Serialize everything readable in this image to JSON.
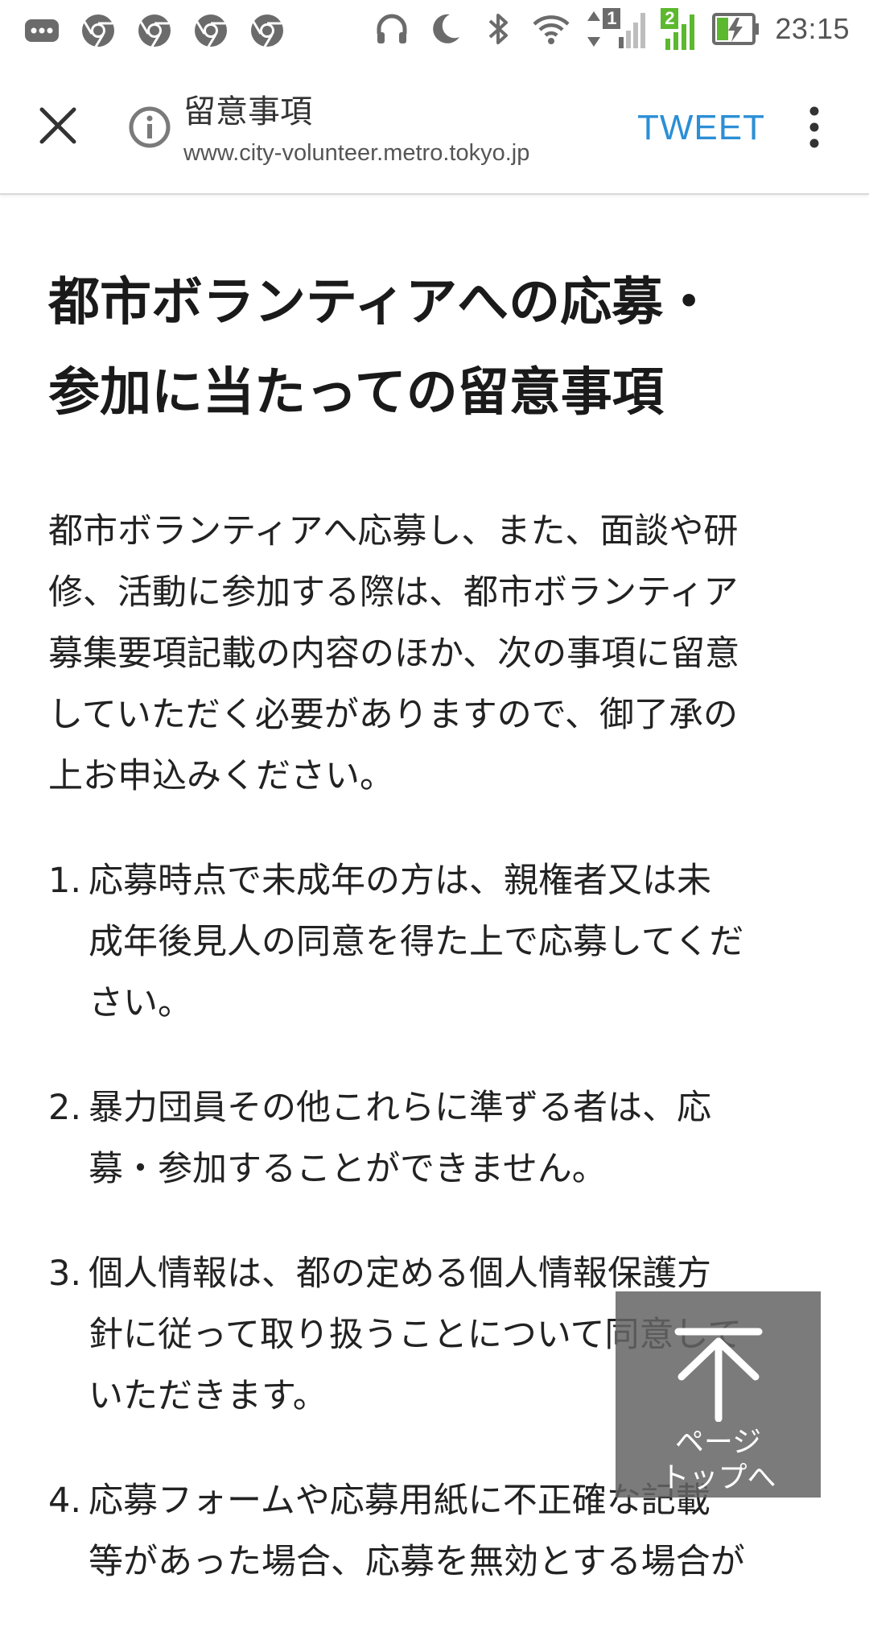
{
  "status_bar": {
    "time": "23:15",
    "sim1_label": "1",
    "sim2_label": "2",
    "notification_icons": [
      "more-icon",
      "chrome-icon",
      "chrome-icon",
      "chrome-icon",
      "chrome-icon"
    ],
    "system_icons": [
      "headphones-icon",
      "moon-icon",
      "bluetooth-icon",
      "wifi-icon",
      "signal-sim1-icon",
      "signal-sim2-icon",
      "battery-charging-icon"
    ]
  },
  "toolbar": {
    "title": "留意事項",
    "url": "www.city-volunteer.metro.tokyo.jp",
    "tweet_label": "TWEET",
    "accent_color": "#2b8fd6"
  },
  "main": {
    "title_line1": "都市ボランティアへの応募・",
    "title_line2": "参加に当たっての留意事項",
    "intro_lines": [
      "都市ボランティアへ応募し、また、面談や研",
      "修、活動に参加する際は、都市ボランティア",
      "募集要項記載の内容のほか、次の事項に留意",
      "していただく必要がありますので、御了承の",
      "上お申込みください。"
    ],
    "notes": [
      {
        "num": "1.",
        "lines": [
          "応募時点で未成年の方は、親権者又は未",
          "成年後見人の同意を得た上で応募してくだ",
          "さい。"
        ]
      },
      {
        "num": "2.",
        "lines": [
          "暴力団員その他これらに準ずる者は、応",
          "募・参加することができません。"
        ]
      },
      {
        "num": "3.",
        "lines": [
          "個人情報は、都の定める個人情報保護方",
          "針に従って取り扱うことについて同意して",
          "いただきます。"
        ]
      },
      {
        "num": "4.",
        "lines": [
          "応募フォームや応募用紙に不正確な記載",
          "等があった場合、応募を無効とする場合が"
        ]
      }
    ]
  },
  "back_to_top": {
    "line1": "ページ",
    "line2": "トップへ"
  }
}
